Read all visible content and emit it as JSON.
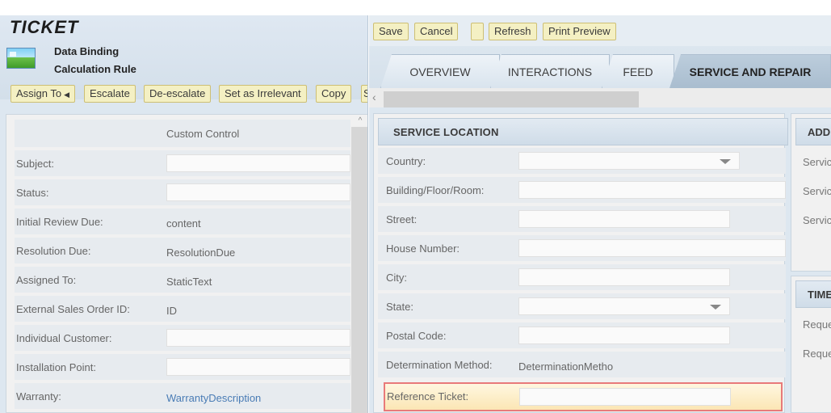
{
  "ticket": {
    "title": "TICKET",
    "sub_line_1": "Data Binding",
    "sub_line_2": "Calculation Rule",
    "icon": "ticket-image-icon"
  },
  "actions": {
    "assign_to": "Assign To",
    "escalate": "Escalate",
    "de_escalate": "De-escalate",
    "set_irrelevant": "Set as Irrelevant",
    "copy": "Copy",
    "cut_off": "S"
  },
  "form": {
    "header_value": "Custom Control",
    "rows": [
      {
        "label": "Subject:",
        "value": ""
      },
      {
        "label": "Status:",
        "value": ""
      },
      {
        "label": "Initial Review Due:",
        "value": "content"
      },
      {
        "label": "Resolution Due:",
        "value": "ResolutionDue"
      },
      {
        "label": "Assigned To:",
        "value": "StaticText"
      },
      {
        "label": "External Sales Order ID:",
        "value": "ID"
      },
      {
        "label": "Individual Customer:",
        "value": ""
      },
      {
        "label": "Installation Point:",
        "value": ""
      },
      {
        "label": "Warranty:",
        "value": "WarrantyDescription"
      }
    ]
  },
  "toolbar": {
    "save": "Save",
    "cancel": "Cancel",
    "blank": "",
    "refresh": "Refresh",
    "print_preview": "Print Preview"
  },
  "tabs": [
    {
      "label": "OVERVIEW",
      "active": false
    },
    {
      "label": "INTERACTIONS",
      "active": false
    },
    {
      "label": "FEED",
      "active": false
    },
    {
      "label": "SERVICE AND REPAIR",
      "active": true
    }
  ],
  "service_location": {
    "title": "SERVICE LOCATION",
    "rows": [
      {
        "label": "Country:",
        "type": "select",
        "value": ""
      },
      {
        "label": "Building/Floor/Room:",
        "type": "input",
        "value": ""
      },
      {
        "label": "Street:",
        "type": "input",
        "value": ""
      },
      {
        "label": "House Number:",
        "type": "input",
        "value": ""
      },
      {
        "label": "City:",
        "type": "input",
        "value": ""
      },
      {
        "label": "State:",
        "type": "select",
        "value": ""
      },
      {
        "label": "Postal Code:",
        "type": "input",
        "value": ""
      },
      {
        "label": "Determination Method:",
        "type": "text",
        "value": "DeterminationMetho"
      },
      {
        "label": "Reference Ticket:",
        "type": "input",
        "value": ""
      }
    ]
  },
  "additional_panel": {
    "title": "ADD",
    "lines": [
      "Servic",
      "Servic",
      "Servic"
    ]
  },
  "time_panel": {
    "title": "TIME",
    "lines": [
      "Reque",
      "Reque"
    ]
  }
}
